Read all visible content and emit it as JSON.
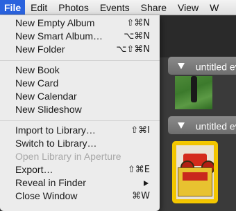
{
  "menubar": {
    "items": [
      {
        "label": "File",
        "active": true
      },
      {
        "label": "Edit"
      },
      {
        "label": "Photos"
      },
      {
        "label": "Events"
      },
      {
        "label": "Share"
      },
      {
        "label": "View"
      },
      {
        "label": "W"
      }
    ]
  },
  "file_menu": {
    "group1": [
      {
        "label": "New Empty Album",
        "shortcut": "⇧⌘N"
      },
      {
        "label": "New Smart Album…",
        "shortcut": "⌥⌘N"
      },
      {
        "label": "New Folder",
        "shortcut": "⌥⇧⌘N"
      }
    ],
    "group2": [
      {
        "label": "New Book"
      },
      {
        "label": "New Card"
      },
      {
        "label": "New Calendar"
      },
      {
        "label": "New Slideshow"
      }
    ],
    "group3": [
      {
        "label": "Import to Library…",
        "shortcut": "⇧⌘I"
      },
      {
        "label": "Switch to Library…"
      },
      {
        "label": "Open Library in Aperture",
        "disabled": true
      },
      {
        "label": "Export…",
        "shortcut": "⇧⌘E"
      },
      {
        "label": "Reveal in Finder",
        "submenu": true
      },
      {
        "label": "Close Window",
        "shortcut": "⌘W"
      }
    ]
  },
  "events": {
    "event1_title": "untitled ev",
    "event2_title": "untitled ev"
  },
  "colors": {
    "menu_highlight": "#2a63de",
    "selection_border": "#f2c400"
  },
  "icons": {
    "disclosure": "disclosure-triangle-icon",
    "submenu": "submenu-arrow-icon"
  }
}
